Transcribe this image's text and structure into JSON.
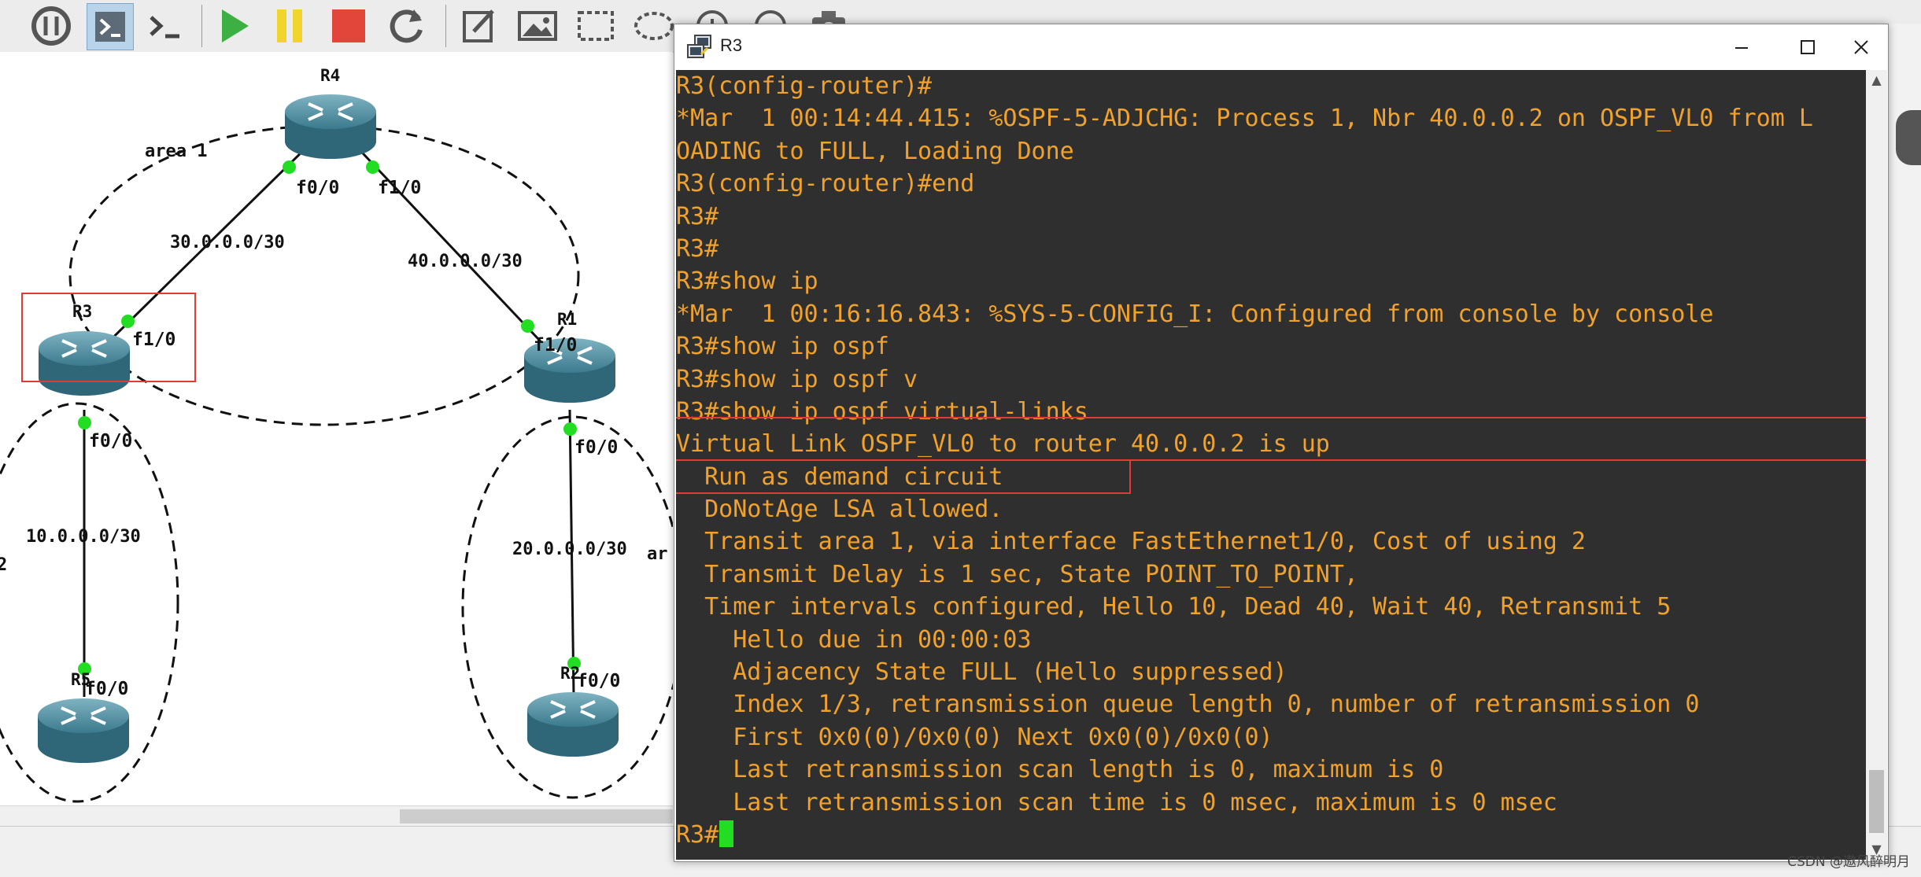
{
  "terminal_window": {
    "title": "R3",
    "lines": [
      "R3(config-router)#",
      "*Mar  1 00:14:44.415: %OSPF-5-ADJCHG: Process 1, Nbr 40.0.0.2 on OSPF_VL0 from L",
      "OADING to FULL, Loading Done",
      "R3(config-router)#end",
      "R3#",
      "R3#",
      "R3#show ip",
      "*Mar  1 00:16:16.843: %SYS-5-CONFIG_I: Configured from console by console",
      "R3#show ip ospf",
      "R3#show ip ospf v",
      "R3#show ip ospf virtual-links",
      "Virtual Link OSPF_VL0 to router 40.0.0.2 is up",
      "  Run as demand circuit",
      "  DoNotAge LSA allowed.",
      "  Transit area 1, via interface FastEthernet1/0, Cost of using 2",
      "  Transmit Delay is 1 sec, State POINT_TO_POINT,",
      "  Timer intervals configured, Hello 10, Dead 40, Wait 40, Retransmit 5",
      "    Hello due in 00:00:03",
      "    Adjacency State FULL (Hello suppressed)",
      "    Index 1/3, retransmission queue length 0, number of retransmission 0",
      "    First 0x0(0)/0x0(0) Next 0x0(0)/0x0(0)",
      "    Last retransmission scan length is 0, maximum is 0",
      "    Last retransmission scan time is 0 msec, maximum is 0 msec",
      "R3#"
    ],
    "colors": {
      "background": "#2f2f2f",
      "text": "#f1a22c",
      "cursor": "#22dd22",
      "highlight": "#e53935"
    }
  },
  "topology": {
    "routers": {
      "r4": "R4",
      "r3": "R3",
      "r1": "R1",
      "r5": "R5",
      "r2": "R2"
    },
    "interfaces": {
      "r4_f0": "f0/0",
      "r4_f1": "f1/0",
      "r3_f1": "f1/0",
      "r3_f0": "f0/0",
      "r1_f1": "f1/0",
      "r1_f0": "f0/0",
      "r5_f0": "f0/0",
      "r2_f0": "f0/0"
    },
    "networks": {
      "r3_r4": "30.0.0.0/30",
      "r4_r1": "40.0.0.0/30",
      "r3_r5": "10.0.0.0/30",
      "r1_r2": "20.0.0.0/30"
    },
    "areas": {
      "top": "area 1",
      "left": "2",
      "right": "ar"
    },
    "link_color": "#111111",
    "port_color": "#22dd22"
  },
  "watermark": "CSDN @遨风醉明月"
}
